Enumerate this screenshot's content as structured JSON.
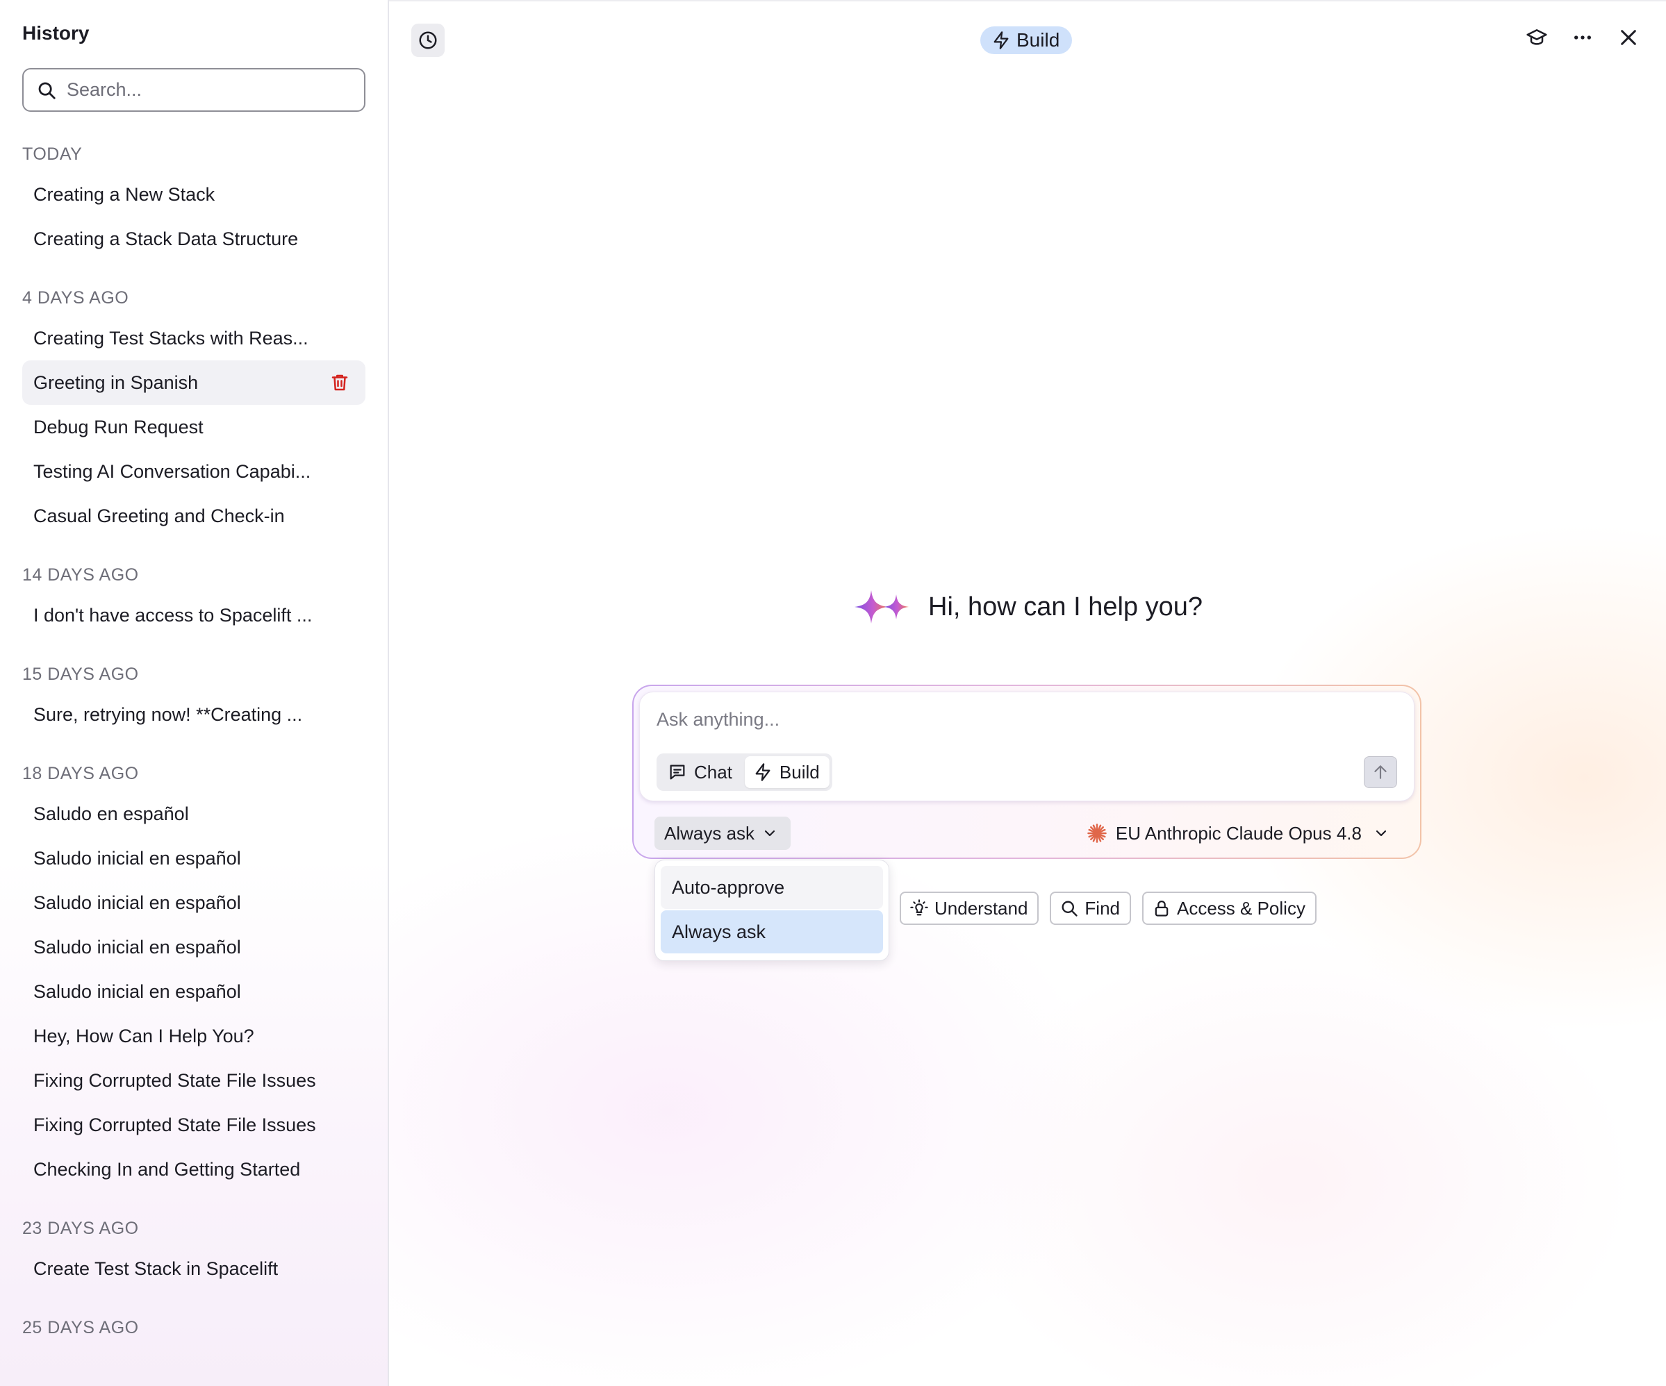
{
  "sidebar": {
    "title": "History",
    "search_placeholder": "Search...",
    "groups": [
      {
        "label": "TODAY",
        "items": [
          "Creating a New Stack",
          "Creating a Stack Data Structure"
        ]
      },
      {
        "label": "4 DAYS AGO",
        "items": [
          "Creating Test Stacks with Reas...",
          "Greeting in Spanish",
          "Debug Run Request",
          "Testing AI Conversation Capabi...",
          "Casual Greeting and Check-in"
        ]
      },
      {
        "label": "14 DAYS AGO",
        "items": [
          "I don't have access to Spacelift ..."
        ]
      },
      {
        "label": "15 DAYS AGO",
        "items": [
          "Sure, retrying now! **Creating ..."
        ]
      },
      {
        "label": "18 DAYS AGO",
        "items": [
          "Saludo en español",
          "Saludo inicial en español",
          "Saludo inicial en español",
          "Saludo inicial en español",
          "Saludo inicial en español",
          "Hey, How Can I Help You?",
          "Fixing Corrupted State File Issues",
          "Fixing Corrupted State File Issues",
          "Checking In and Getting Started"
        ]
      },
      {
        "label": "23 DAYS AGO",
        "items": [
          "Create Test Stack in Spacelift"
        ]
      },
      {
        "label": "25 DAYS AGO",
        "items": []
      }
    ],
    "active_item": "Greeting in Spanish"
  },
  "header": {
    "mode_label": "Build",
    "icons": [
      "history-icon",
      "graduation-cap-icon",
      "more-icon",
      "close-icon"
    ]
  },
  "main": {
    "greeting": "Hi, how can I help you?",
    "composer": {
      "placeholder": "Ask anything...",
      "modes": [
        "Chat",
        "Build"
      ],
      "selected_mode": "Build",
      "approval_value": "Always ask",
      "model_value": "EU Anthropic Claude Opus 4.8"
    },
    "approval_options": [
      "Auto-approve",
      "Always ask"
    ],
    "approval_selected": "Always ask",
    "suggestions": [
      "Understand",
      "Find",
      "Access & Policy"
    ]
  },
  "colors": {
    "accent_pill": "#cfe1fb",
    "selected_option": "#d6e6fb",
    "trash_icon": "#d4231e",
    "model_spark": "#e0674a"
  }
}
